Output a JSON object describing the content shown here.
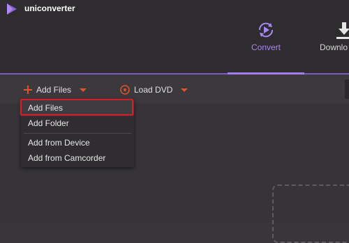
{
  "app": {
    "title": "uniconverter",
    "accent_color": "#a27ef0"
  },
  "nav": {
    "tabs": [
      {
        "label": "Convert",
        "icon": "convert-icon",
        "active": true
      },
      {
        "label": "Downlo",
        "icon": "download-icon",
        "active": false
      }
    ]
  },
  "toolbar": {
    "add_files_label": "Add Files",
    "load_dvd_label": "Load DVD"
  },
  "dropdown": {
    "items": [
      "Add Files",
      "Add Folder",
      "Add from Device",
      "Add from Camcorder"
    ],
    "highlighted_index": 0,
    "highlight_color": "#d0202a"
  }
}
